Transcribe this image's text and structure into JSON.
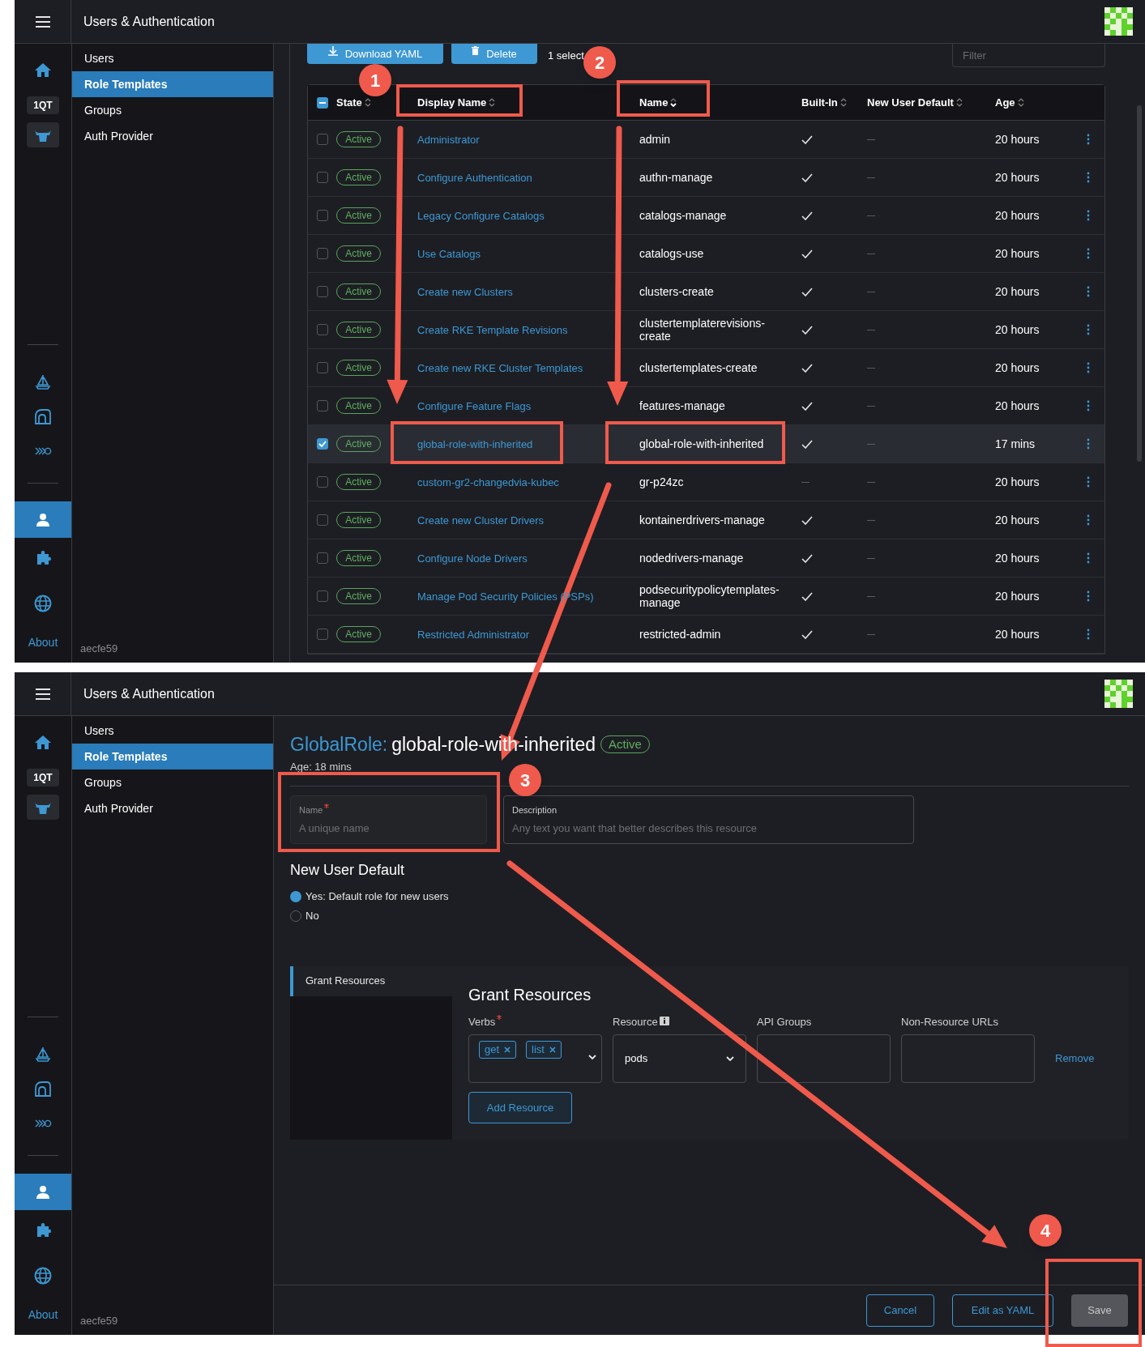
{
  "list_view": {
    "header": {
      "title": "Users & Authentication"
    },
    "rail": {
      "cluster_label": "1QT",
      "tools": [
        {
          "kind": "boat"
        },
        {
          "kind": "arch"
        },
        {
          "kind": "chevrons"
        }
      ],
      "apps": [
        {
          "kind": "user",
          "selected": true
        },
        {
          "kind": "puzzle",
          "selected": false
        },
        {
          "kind": "globe",
          "selected": false
        }
      ],
      "about": "About"
    },
    "sidebar": {
      "items": [
        {
          "label": "Users",
          "selected": false
        },
        {
          "label": "Role Templates",
          "selected": true
        },
        {
          "label": "Groups",
          "selected": false
        },
        {
          "label": "Auth Provider",
          "selected": false
        }
      ],
      "version": "aecfe59"
    },
    "toolbar": {
      "buttons": [
        {
          "label": "Download YAML",
          "kind": "download"
        },
        {
          "label": "Delete",
          "kind": "delete"
        }
      ],
      "selection": "1 select",
      "filter_placeholder": "Filter"
    },
    "table": {
      "select_all": {
        "indeterminate": true
      },
      "columns": [
        {
          "label": "State",
          "sorted": false
        },
        {
          "label": "Display Name",
          "sorted": false
        },
        {
          "label": "Name",
          "sorted": true
        },
        {
          "label": "Built-In",
          "sorted": false
        },
        {
          "label": "New User Default",
          "sorted": false
        },
        {
          "label": "Age",
          "sorted": false
        }
      ],
      "rows": [
        {
          "selected": false,
          "state": "Active",
          "display_name": "Administrator",
          "name": "admin",
          "built_in": true,
          "new_user_default": false,
          "age": "20 hours"
        },
        {
          "selected": false,
          "state": "Active",
          "display_name": "Configure Authentication",
          "name": "authn-manage",
          "built_in": true,
          "new_user_default": false,
          "age": "20 hours"
        },
        {
          "selected": false,
          "state": "Active",
          "display_name": "Legacy Configure Catalogs",
          "name": "catalogs-manage",
          "built_in": true,
          "new_user_default": false,
          "age": "20 hours"
        },
        {
          "selected": false,
          "state": "Active",
          "display_name": "Use Catalogs",
          "name": "catalogs-use",
          "built_in": true,
          "new_user_default": false,
          "age": "20 hours"
        },
        {
          "selected": false,
          "state": "Active",
          "display_name": "Create new Clusters",
          "name": "clusters-create",
          "built_in": true,
          "new_user_default": false,
          "age": "20 hours"
        },
        {
          "selected": false,
          "state": "Active",
          "display_name": "Create RKE Template Revisions",
          "name": "clustertemplaterevisions-create",
          "built_in": true,
          "new_user_default": false,
          "age": "20 hours"
        },
        {
          "selected": false,
          "state": "Active",
          "display_name": "Create new RKE Cluster Templates",
          "name": "clustertemplates-create",
          "built_in": true,
          "new_user_default": false,
          "age": "20 hours"
        },
        {
          "selected": false,
          "state": "Active",
          "display_name": "Configure Feature Flags",
          "name": "features-manage",
          "built_in": true,
          "new_user_default": false,
          "age": "20 hours"
        },
        {
          "selected": true,
          "state": "Active",
          "display_name": "global-role-with-inherited",
          "name": "global-role-with-inherited",
          "built_in": true,
          "new_user_default": false,
          "age": "17 mins"
        },
        {
          "selected": false,
          "state": "Active",
          "display_name": "custom-gr2-changedvia-kubec",
          "name": "gr-p24zc",
          "built_in": false,
          "new_user_default": false,
          "age": "20 hours"
        },
        {
          "selected": false,
          "state": "Active",
          "display_name": "Create new Cluster Drivers",
          "name": "kontainerdrivers-manage",
          "built_in": true,
          "new_user_default": false,
          "age": "20 hours"
        },
        {
          "selected": false,
          "state": "Active",
          "display_name": "Configure Node Drivers",
          "name": "nodedrivers-manage",
          "built_in": true,
          "new_user_default": false,
          "age": "20 hours"
        },
        {
          "selected": false,
          "state": "Active",
          "display_name": "Manage Pod Security Policies (PSPs)",
          "name": "podsecuritypolicytemplates-manage",
          "built_in": true,
          "new_user_default": false,
          "age": "20 hours"
        },
        {
          "selected": false,
          "state": "Active",
          "display_name": "Restricted Administrator",
          "name": "restricted-admin",
          "built_in": true,
          "new_user_default": false,
          "age": "20 hours"
        }
      ]
    }
  },
  "edit_view": {
    "header": {
      "title": "Users & Authentication"
    },
    "rail": {
      "cluster_label": "1QT",
      "tools": [
        {
          "kind": "boat"
        },
        {
          "kind": "arch"
        },
        {
          "kind": "chevrons"
        }
      ],
      "apps": [
        {
          "kind": "user",
          "selected": true
        },
        {
          "kind": "puzzle",
          "selected": false
        },
        {
          "kind": "globe",
          "selected": false
        }
      ],
      "about": "About"
    },
    "sidebar": {
      "items": [
        {
          "label": "Users",
          "selected": false
        },
        {
          "label": "Role Templates",
          "selected": true
        },
        {
          "label": "Groups",
          "selected": false
        },
        {
          "label": "Auth Provider",
          "selected": false
        }
      ],
      "version": "aecfe59"
    },
    "title_prefix": "GlobalRole:",
    "title_name": "global-role-with-inherited",
    "status": "Active",
    "age": "Age: 18 mins",
    "name_field": {
      "label": "Name",
      "required": true,
      "placeholder": "A unique name"
    },
    "description_field": {
      "label": "Description",
      "placeholder": "Any text you want that better describes this resource"
    },
    "new_user_default": {
      "title": "New User Default",
      "options": [
        {
          "label": "Yes: Default role for new users",
          "selected": true
        },
        {
          "label": "No",
          "selected": false
        }
      ]
    },
    "grant": {
      "tab": {
        "label": "Grant Resources",
        "selected": true
      },
      "heading": "Grant Resources",
      "columns": [
        {
          "label": "Verbs",
          "required": true,
          "info": false
        },
        {
          "label": "Resource",
          "required": false,
          "info": true
        },
        {
          "label": "API Groups",
          "required": false,
          "info": false
        },
        {
          "label": "Non-Resource URLs",
          "required": false,
          "info": false
        }
      ],
      "verbs": [
        "get",
        "list"
      ],
      "resource": "pods",
      "remove": "Remove",
      "add": "Add Resource"
    },
    "footer": [
      {
        "label": "Cancel",
        "disabled": false
      },
      {
        "label": "Edit as YAML",
        "disabled": false
      },
      {
        "label": "Save",
        "disabled": true
      }
    ]
  },
  "annotations": {
    "badges": [
      {
        "label": "1"
      },
      {
        "label": "2"
      },
      {
        "label": "3"
      },
      {
        "label": "4"
      }
    ]
  }
}
